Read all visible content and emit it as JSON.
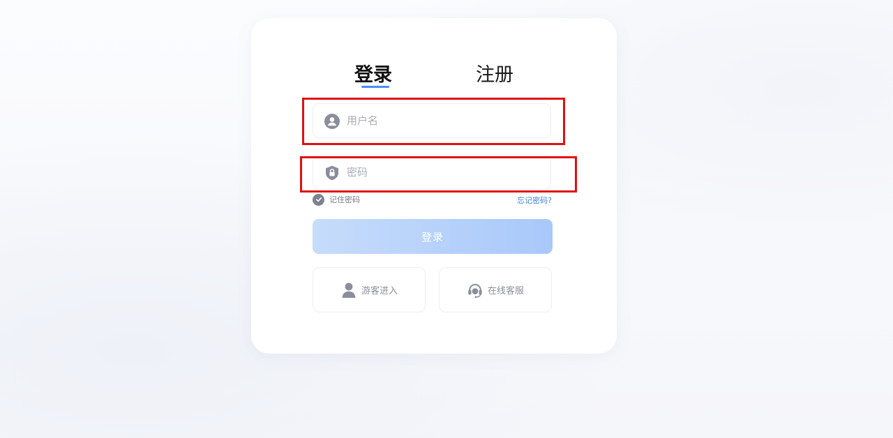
{
  "tabs": {
    "login": "登录",
    "register": "注册"
  },
  "form": {
    "username_placeholder": "用户名",
    "username_value": "",
    "password_placeholder": "密码",
    "password_value": "",
    "remember_label": "记住密码",
    "forgot_link": "忘记密码?",
    "login_button": "登录"
  },
  "secondary": {
    "guest_label": "游客进入",
    "service_label": "在线客服"
  },
  "icons": {
    "user": "user-circle-icon",
    "password": "shield-lock-icon",
    "check": "check-circle-icon",
    "guest": "person-icon",
    "service": "headset-icon"
  },
  "colors": {
    "accent": "#4a8df0",
    "link": "#3d7fe0",
    "button_gradient_start": "#c6dcfb",
    "button_gradient_end": "#a9c8fa",
    "highlight": "#e01010"
  }
}
